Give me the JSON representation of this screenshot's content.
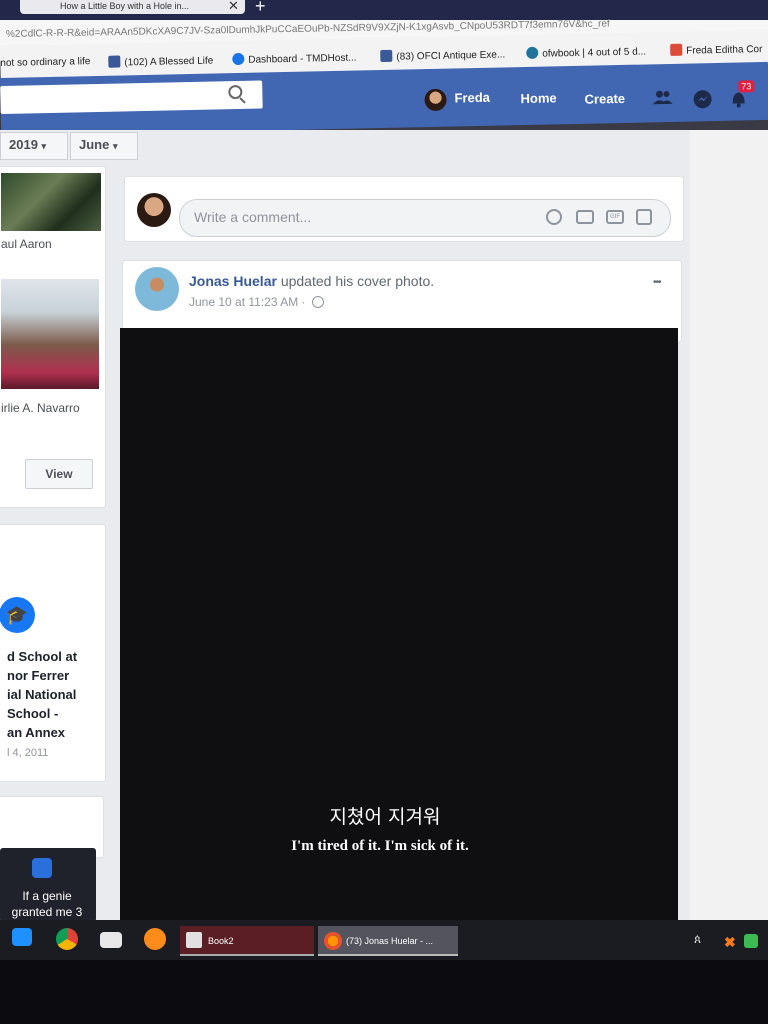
{
  "browser": {
    "tab_title": "How a Little Boy with a Hole in...",
    "tab_close": "✕",
    "new_tab": "+",
    "url": "%2CdlC-R-R-R&eid=ARAAn5DKcXA9C7JV-Sza0lDumhJkPuCCaEOuPb-NZSdR9V9XZjN-K1xgAsvb_CNpoU53RDT7f3emn76V&hc_ref",
    "bookmarks": [
      {
        "label": "not so ordinary a life",
        "icon_color": "",
        "icon": ""
      },
      {
        "label": "(102) A Blessed Life",
        "icon_color": "#3b5998",
        "icon": "facebook-icon"
      },
      {
        "label": "Dashboard - TMDHost...",
        "icon_color": "#1a73e8",
        "icon": "tmd-icon"
      },
      {
        "label": "(83) OFCI Antique Exe...",
        "icon_color": "#3b5998",
        "icon": "facebook-icon"
      },
      {
        "label": "ofwbook | 4 out of 5 d...",
        "icon_color": "#21759b",
        "icon": "wordpress-icon"
      },
      {
        "label": "Freda Editha Cor",
        "icon_color": "#dd4b39",
        "icon": "google-plus-icon"
      }
    ]
  },
  "header": {
    "user_name": "Freda",
    "home": "Home",
    "create": "Create",
    "notif_count": "73"
  },
  "left": {
    "year": "2019",
    "month": "June",
    "friend1_name": "aul Aaron",
    "friend2_name": "irlie A. Navarro",
    "view_label": "View",
    "school_lines": [
      "d School at",
      "nor Ferrer",
      "ial National",
      "School -",
      "an Annex"
    ],
    "school_date": "l 4, 2011",
    "genie_text": "If a genie granted me 3"
  },
  "comment_box": {
    "placeholder": "Write a comment..."
  },
  "post": {
    "author": "Jonas Huelar",
    "action": "updated his cover photo.",
    "time": "June 10 at 11:23 AM ·",
    "more": "•••",
    "caption_ko": "지쳤어 지겨워",
    "caption_en": "I'm tired of it. I'm sick of it."
  },
  "taskbar": {
    "items": [
      {
        "label": "Book2"
      },
      {
        "label": "(73) Jonas Huelar - ..."
      }
    ],
    "tray_text": "ጰ"
  }
}
